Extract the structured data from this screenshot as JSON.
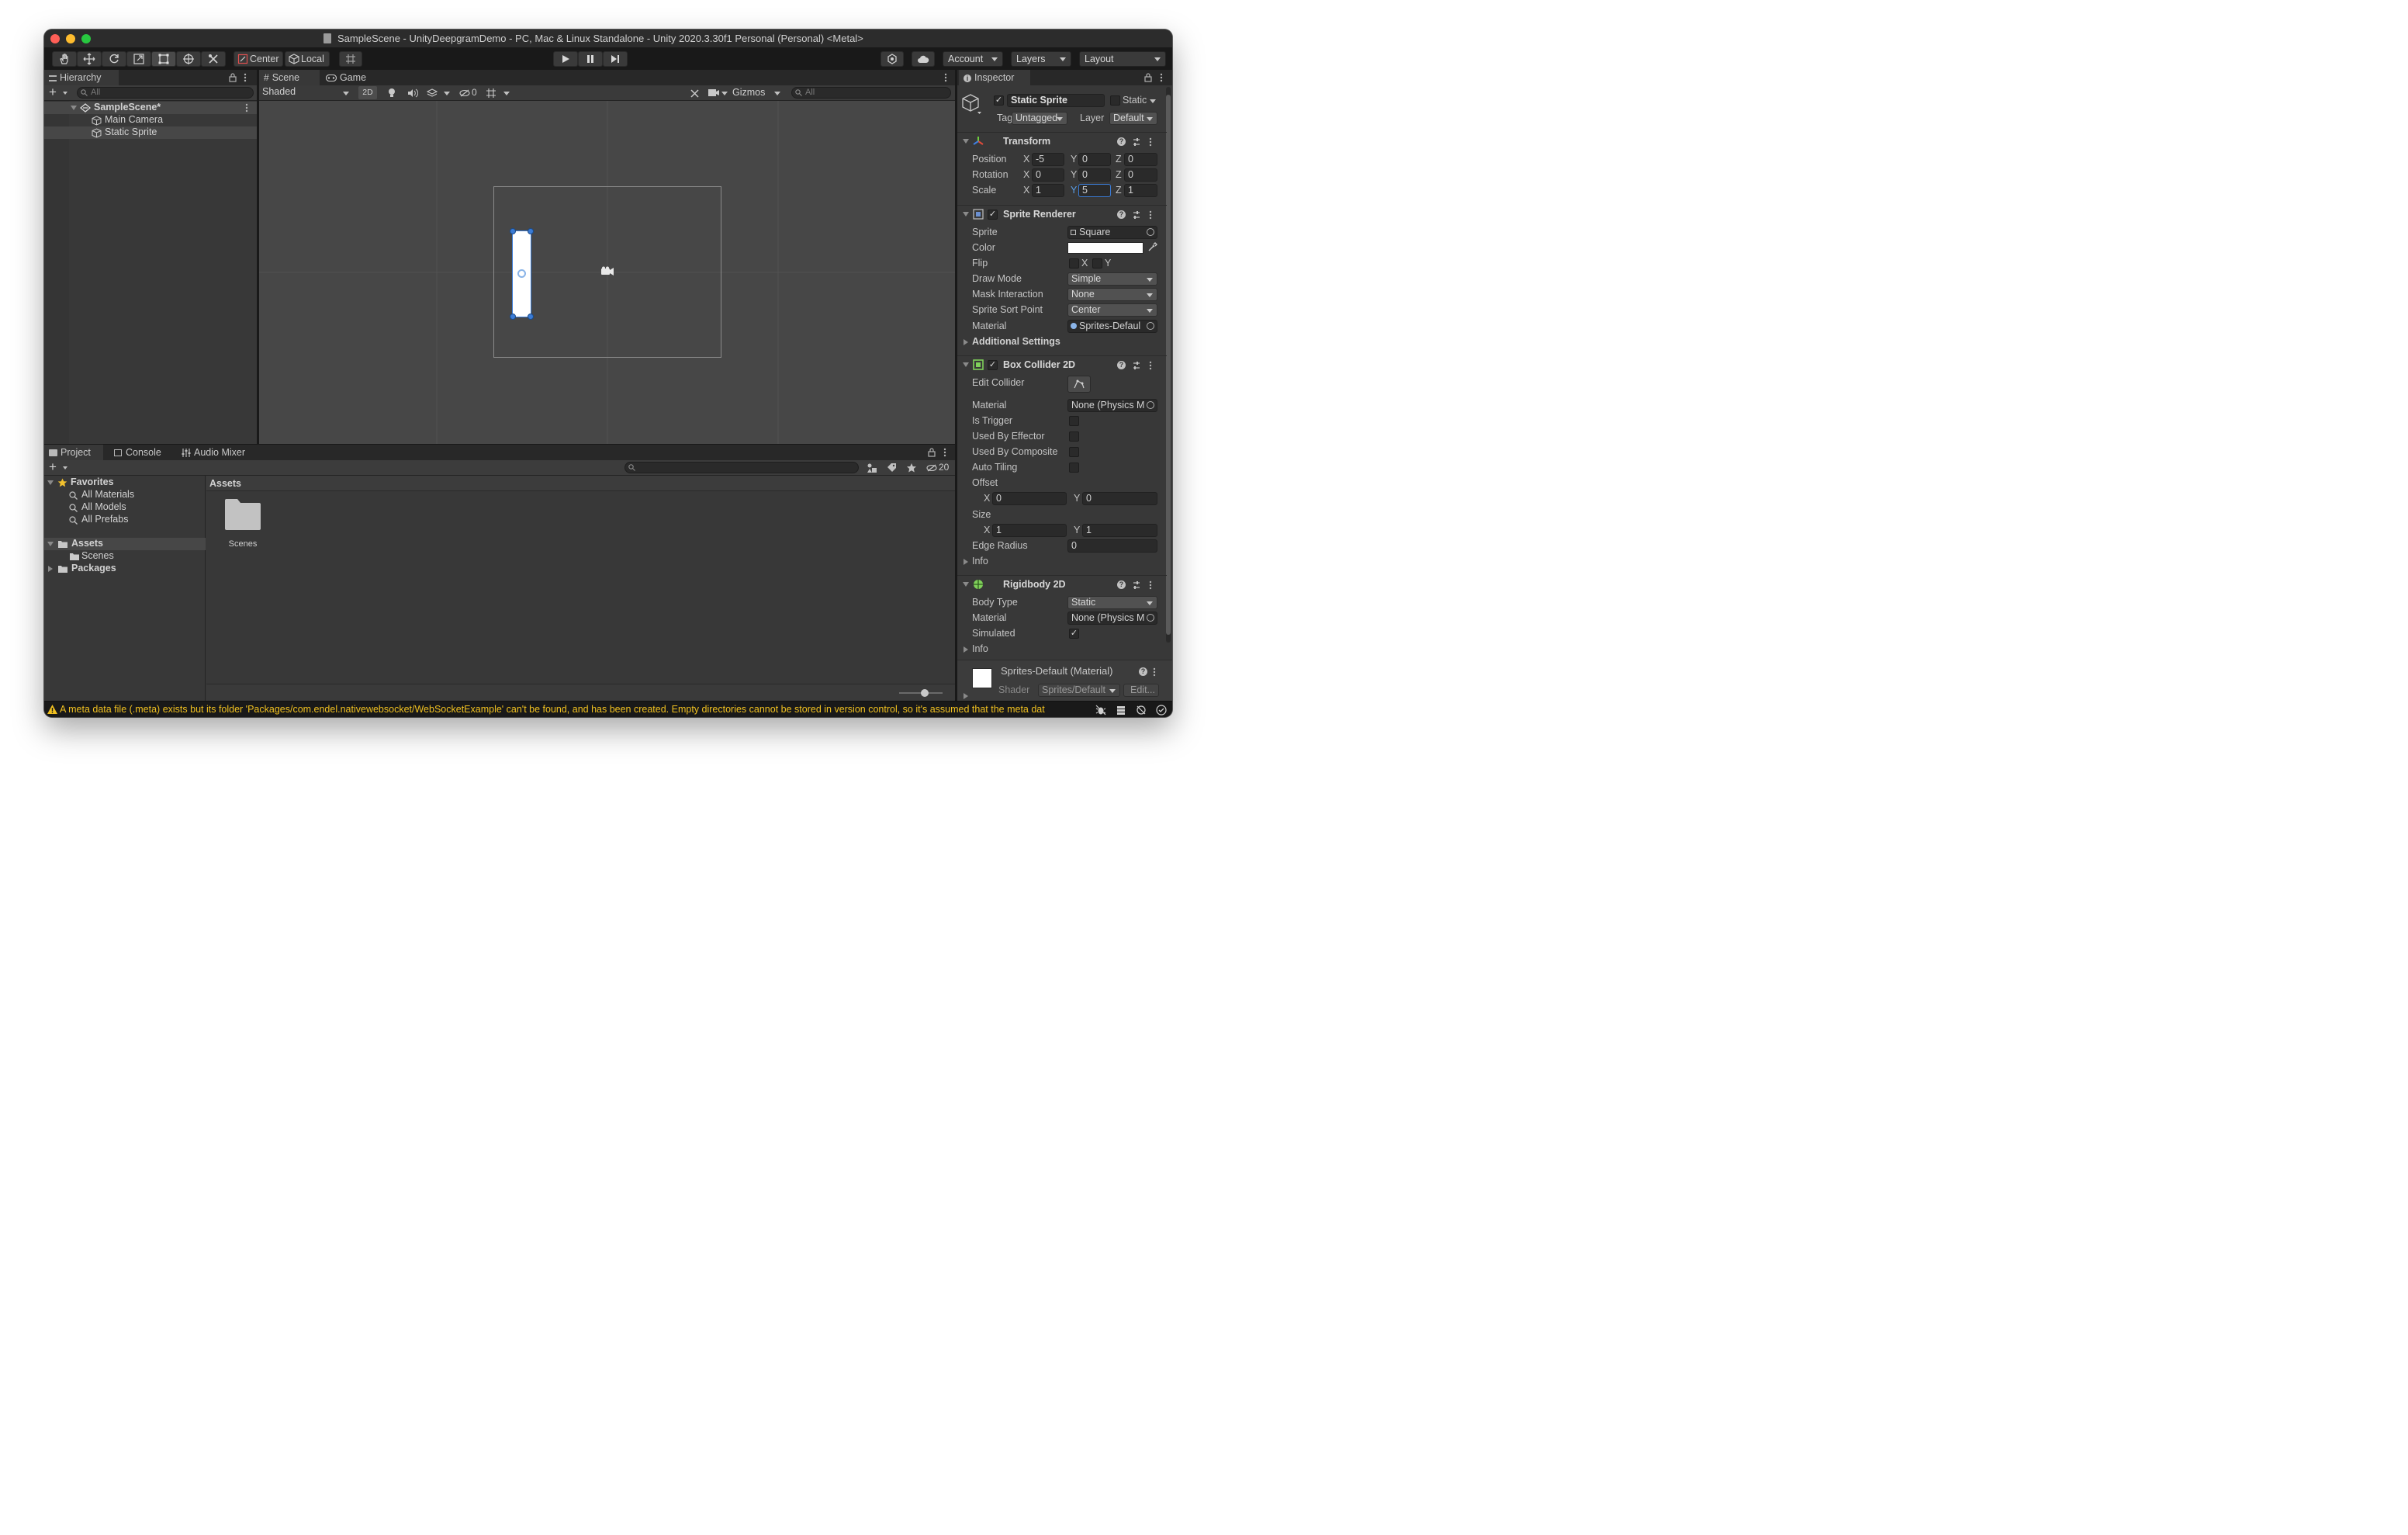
{
  "window": {
    "title": "SampleScene - UnityDeepgramDemo - PC, Mac & Linux Standalone - Unity 2020.3.30f1 Personal (Personal) <Metal>"
  },
  "toolbar": {
    "pivot_mode": "Center",
    "pivot_rotation": "Local",
    "account": "Account",
    "layers": "Layers",
    "layout": "Layout"
  },
  "hierarchy": {
    "tab": "Hierarchy",
    "search_placeholder": "All",
    "scene": "SampleScene*",
    "items": [
      "Main Camera",
      "Static Sprite"
    ]
  },
  "scene_view": {
    "tabs": [
      "Scene",
      "Game"
    ],
    "draw_mode": "Shaded",
    "mode_2d": "2D",
    "hidden_count": "0",
    "gizmos": "Gizmos",
    "search_placeholder": "All"
  },
  "project": {
    "tabs": [
      "Project",
      "Console",
      "Audio Mixer"
    ],
    "hidden_count": "20",
    "favorites": {
      "label": "Favorites",
      "items": [
        "All Materials",
        "All Models",
        "All Prefabs"
      ]
    },
    "tree": {
      "assets": "Assets",
      "scenes": "Scenes",
      "packages": "Packages"
    },
    "breadcrumb": "Assets",
    "folders": [
      "Scenes"
    ]
  },
  "inspector": {
    "tab": "Inspector",
    "object_name": "Static Sprite",
    "static_label": "Static",
    "tag_label": "Tag",
    "tag_value": "Untagged",
    "layer_label": "Layer",
    "layer_value": "Default",
    "transform": {
      "name": "Transform",
      "position_label": "Position",
      "rotation_label": "Rotation",
      "scale_label": "Scale",
      "position": {
        "x": "-5",
        "y": "0",
        "z": "0"
      },
      "rotation": {
        "x": "0",
        "y": "0",
        "z": "0"
      },
      "scale": {
        "x": "1",
        "y": "5",
        "z": "1"
      }
    },
    "sprite_renderer": {
      "name": "Sprite Renderer",
      "sprite_label": "Sprite",
      "sprite_value": "Square",
      "color_label": "Color",
      "color_value": "#ffffff",
      "flip_label": "Flip",
      "flip_x": "X",
      "flip_y": "Y",
      "draw_mode_label": "Draw Mode",
      "draw_mode_value": "Simple",
      "mask_label": "Mask Interaction",
      "mask_value": "None",
      "sort_label": "Sprite Sort Point",
      "sort_value": "Center",
      "material_label": "Material",
      "material_value": "Sprites-Defaul",
      "additional": "Additional Settings"
    },
    "box_collider": {
      "name": "Box Collider 2D",
      "edit_label": "Edit Collider",
      "material_label": "Material",
      "material_value": "None (Physics M",
      "trigger_label": "Is Trigger",
      "effector_label": "Used By Effector",
      "composite_label": "Used By Composite",
      "tiling_label": "Auto Tiling",
      "offset_label": "Offset",
      "offset": {
        "x": "0",
        "y": "0"
      },
      "size_label": "Size",
      "size": {
        "x": "1",
        "y": "1"
      },
      "edge_label": "Edge Radius",
      "edge_value": "0",
      "info": "Info",
      "x_label": "X",
      "y_label": "Y"
    },
    "rigidbody": {
      "name": "Rigidbody 2D",
      "body_label": "Body Type",
      "body_value": "Static",
      "material_label": "Material",
      "material_value": "None (Physics M",
      "simulated_label": "Simulated",
      "info": "Info"
    },
    "material_preview": {
      "name": "Sprites-Default (Material)",
      "shader_label": "Shader",
      "shader_value": "Sprites/Default",
      "edit": "Edit..."
    }
  },
  "status_bar": {
    "message": "A meta data file (.meta) exists but its folder 'Packages/com.endel.nativewebsocket/WebSocketExample' can't be found, and has been created. Empty directories cannot be stored in version control, so it's assumed that the meta dat"
  },
  "colors": {
    "accent": "#2c5d87",
    "warning": "#f0c020"
  }
}
